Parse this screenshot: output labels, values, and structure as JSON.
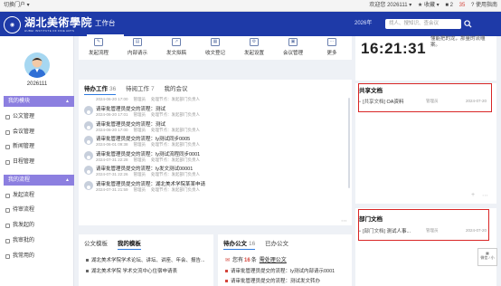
{
  "topbar": {
    "portal_switch": "切换门户 ▾",
    "welcome": "欢迎您 2026111 ▾",
    "favorites": "★ 收藏 ▾",
    "count": "35",
    "help": "? 使用指南",
    "tag": "■ 2"
  },
  "header": {
    "school_name": "湖北美術學院",
    "school_en": "HUBEI INSTITUTE OF FINE ARTS",
    "tab_workbench": "工作台",
    "date": "2026年",
    "search_placeholder": "找人、搜知识、查会议"
  },
  "sidebar": {
    "user_id": "2026111",
    "section_modules": "我的模块",
    "modules": [
      "公文管理",
      "会议管理",
      "新闻管理",
      "日程管理"
    ],
    "section_flow": "我的流程",
    "flows": [
      "发起流程",
      "待审流程",
      "我发起的",
      "我审批的",
      "我常用的"
    ]
  },
  "quick_apps": [
    {
      "icon": "edit-icon",
      "glyph": "✎",
      "label": "发起流程"
    },
    {
      "icon": "inbox-icon",
      "glyph": "▤",
      "label": "内部请示"
    },
    {
      "icon": "send-icon",
      "glyph": "↗",
      "label": "发文拟稿"
    },
    {
      "icon": "register-icon",
      "glyph": "▦",
      "label": "收文登记"
    },
    {
      "icon": "settings-icon",
      "glyph": "⚙",
      "label": "发起设置"
    },
    {
      "icon": "meeting-icon",
      "glyph": "▣",
      "label": "会议管理"
    },
    {
      "icon": "more-icon",
      "glyph": "⋯",
      "label": "更多"
    }
  ],
  "clock": {
    "time": "16:21:31",
    "greeting": "懂能把的龙，那量的流缰 案。"
  },
  "todo": {
    "tabs": [
      {
        "label": "待办工作",
        "count": "36"
      },
      {
        "label": "待阅工作",
        "count": "7"
      },
      {
        "label": "我的会议",
        "count": ""
      }
    ],
    "items": [
      {
        "title": "",
        "time": "2024-06-20 17:00",
        "owner": "管理员",
        "node": "处理节点：发起部门负责人"
      },
      {
        "title": "请审批管理员提交的流程：测试",
        "time": "2024-06-20 17:01",
        "owner": "管理员",
        "node": "处理节点：发起部门负责人"
      },
      {
        "title": "请审批管理员提交的流程：测试",
        "time": "2024-06-20 17:00",
        "owner": "管理员",
        "node": "处理节点：发起部门负责人"
      },
      {
        "title": "请审批管理员提交的流程：ly测试同步0005",
        "time": "2024-06-01 09:38",
        "owner": "管理员",
        "node": "处理节点：发起部门负责人"
      },
      {
        "title": "请审批管理员提交的流程：ly测试流程同步0001",
        "time": "2024-07-31 22:28",
        "owner": "管理员",
        "node": "处理节点：发起部门负责人"
      },
      {
        "title": "请审批管理员提交的流程：ly发文测试00001",
        "time": "2024-07-31 22:26",
        "owner": "管理员",
        "node": "处理节点：发起部门负责人"
      },
      {
        "title": "请审批管理员提交的流程：湖北美术学院某某申请",
        "time": "2024-07-31 21:59",
        "owner": "管理员",
        "node": "处理节点：发起部门负责人"
      }
    ]
  },
  "shared_docs": {
    "title": "共享文档",
    "items": [
      {
        "tag": "[共享文档]",
        "name": "OA资料",
        "owner": "管理员",
        "date": "2024-07-20"
      }
    ]
  },
  "templates": {
    "tabs": [
      {
        "label": "公文模板"
      },
      {
        "label": "我的模板"
      }
    ],
    "items": [
      "湖北美术学院学术论坛、讲坛、讲座、年会、报告...",
      "湖北美术学院 学术交流中心住宿申请表"
    ]
  },
  "pending_docs": {
    "tabs": [
      {
        "label": "待办公文",
        "count": "16"
      },
      {
        "label": "已办公文",
        "count": ""
      }
    ],
    "alert_prefix": "您有",
    "alert_count": "16",
    "alert_suffix": "条",
    "alert_link": "需处理公文",
    "items": [
      "请审批管理员提交的流程：ly测试内部请示0001",
      "请审批管理员提交的流程：测试发文转办"
    ]
  },
  "dept_docs": {
    "title": "部门文档",
    "items": [
      {
        "tag": "[部门文档]",
        "name": "测试人事...",
        "owner": "管理员",
        "date": "2024-07-20"
      }
    ]
  },
  "float_widget": {
    "label": "微信 / 小"
  }
}
